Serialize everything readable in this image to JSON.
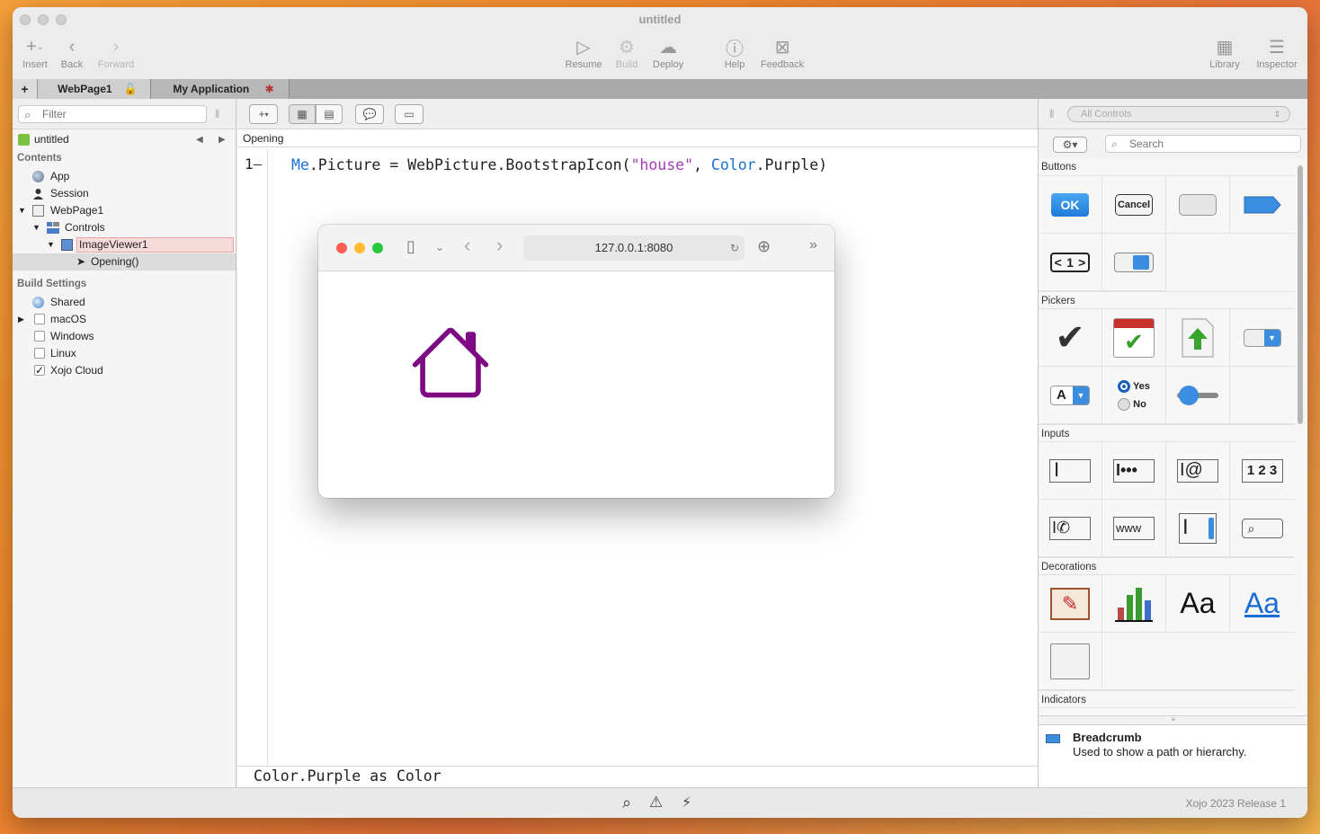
{
  "window": {
    "title": "untitled"
  },
  "toolbar": {
    "insert": "Insert",
    "back": "Back",
    "forward": "Forward",
    "resume": "Resume",
    "build": "Build",
    "deploy": "Deploy",
    "help": "Help",
    "feedback": "Feedback",
    "library": "Library",
    "inspector": "Inspector"
  },
  "tabs": [
    {
      "label": "WebPage1"
    },
    {
      "label": "My Application"
    }
  ],
  "navigator": {
    "filter_placeholder": "Filter",
    "project": "untitled",
    "contents_header": "Contents",
    "items": {
      "app": "App",
      "session": "Session",
      "webpage": "WebPage1",
      "controls": "Controls",
      "imageviewer": "ImageViewer1",
      "opening": "Opening()"
    },
    "build_header": "Build Settings",
    "build_items": [
      {
        "label": "Shared"
      },
      {
        "label": "macOS",
        "checked": false
      },
      {
        "label": "Windows",
        "checked": false
      },
      {
        "label": "Linux",
        "checked": false
      },
      {
        "label": "Xojo Cloud",
        "checked": true
      }
    ]
  },
  "editor": {
    "header": "Opening",
    "line_number": "1",
    "code": {
      "me": "Me",
      "part1": ".Picture = WebPicture.BootstrapIcon(",
      "string": "\"house\"",
      "comma": ", ",
      "color": "Color",
      "part2": ".Purple)"
    },
    "tip": "Color.Purple as Color"
  },
  "browser": {
    "url": "127.0.0.1:8080",
    "icon_color": "#7d0a82"
  },
  "library": {
    "filter": "All Controls",
    "search_placeholder": "Search",
    "categories": {
      "buttons": "Buttons",
      "pickers": "Pickers",
      "inputs": "Inputs",
      "decorations": "Decorations",
      "indicators": "Indicators"
    },
    "button_labels": {
      "ok": "OK",
      "cancel": "Cancel"
    },
    "picker_labels": {
      "yes": "Yes",
      "no": "No",
      "font": "A"
    },
    "segment_label": "1",
    "input_labels": {
      "numeric": "1 2 3",
      "url": "www"
    },
    "deco_label": "Aa",
    "description": {
      "title": "Breadcrumb",
      "text": "Used to show a path or hierarchy."
    }
  },
  "status": {
    "version": "Xojo 2023 Release 1"
  }
}
